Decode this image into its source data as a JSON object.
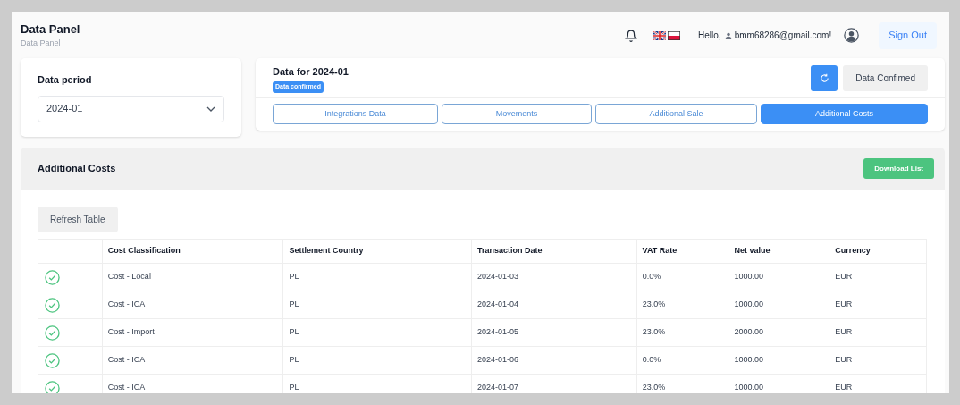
{
  "header": {
    "title": "Data Panel",
    "subtitle": "Data Panel",
    "greeting": "Hello,",
    "email": "bmm68286@gmail.com!",
    "sign_out": "Sign Out"
  },
  "period": {
    "label": "Data period",
    "value": "2024-01"
  },
  "data_card": {
    "title": "Data for 2024-01",
    "badge": "Data confirmed",
    "confirm_button": "Data Confimed"
  },
  "tabs": [
    {
      "label": "Integrations Data",
      "selected": false
    },
    {
      "label": "Movements",
      "selected": false
    },
    {
      "label": "Additional Sale",
      "selected": false
    },
    {
      "label": "Additional Costs",
      "selected": true
    }
  ],
  "section": {
    "title": "Additional Costs",
    "download_button": "Download List",
    "refresh_button": "Refresh Table"
  },
  "table": {
    "columns": [
      "Cost Classification",
      "Settlement Country",
      "Transaction Date",
      "VAT Rate",
      "Net value",
      "Currency"
    ],
    "rows": [
      {
        "confirmed": true,
        "cells": [
          "Cost - Local",
          "PL",
          "2024-01-03",
          "0.0%",
          "1000.00",
          "EUR"
        ]
      },
      {
        "confirmed": true,
        "cells": [
          "Cost - ICA",
          "PL",
          "2024-01-04",
          "23.0%",
          "1000.00",
          "EUR"
        ]
      },
      {
        "confirmed": true,
        "cells": [
          "Cost - Import",
          "PL",
          "2024-01-05",
          "23.0%",
          "2000.00",
          "EUR"
        ]
      },
      {
        "confirmed": true,
        "cells": [
          "Cost - ICA",
          "PL",
          "2024-01-06",
          "0.0%",
          "1000.00",
          "EUR"
        ]
      },
      {
        "confirmed": true,
        "cells": [
          "Cost - ICA",
          "PL",
          "2024-01-07",
          "23.0%",
          "1000.00",
          "EUR"
        ]
      }
    ]
  }
}
